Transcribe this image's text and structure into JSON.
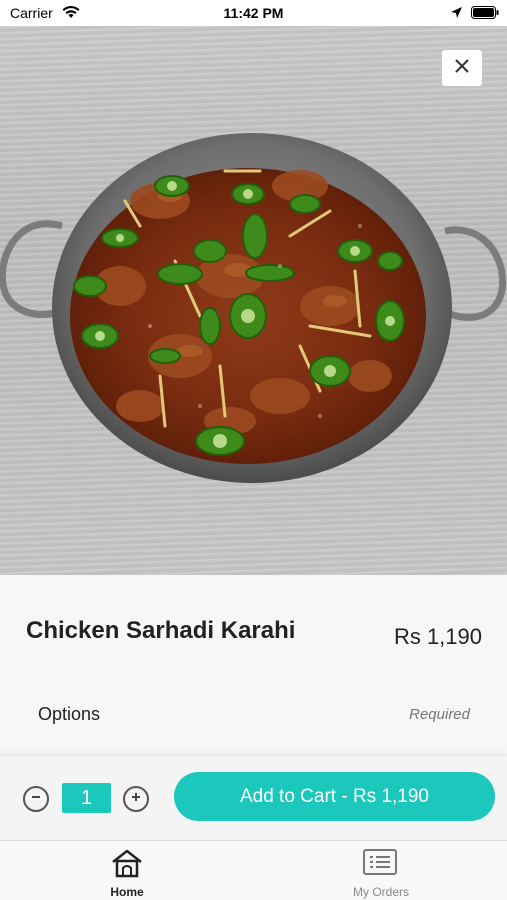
{
  "status_bar": {
    "carrier": "Carrier",
    "time": "11:42 PM",
    "icons": [
      "wifi-icon",
      "location-arrow-icon",
      "battery-icon"
    ]
  },
  "hero": {
    "image": "food-photo-chicken-karahi",
    "close_icon": "close-icon"
  },
  "item": {
    "name": "Chicken Sarhadi Karahi",
    "price": "Rs 1,190"
  },
  "options": {
    "label": "Options",
    "required": "Required"
  },
  "cart": {
    "quantity": "1",
    "minus_icon": "minus-icon",
    "plus_icon": "plus-icon",
    "add_button": "Add to Cart - Rs 1,190"
  },
  "tabs": [
    {
      "label": "Home",
      "icon": "home-icon",
      "active": true
    },
    {
      "label": "My Orders",
      "icon": "orders-list-icon",
      "active": false
    }
  ],
  "colors": {
    "accent": "#1cc8bb",
    "text": "#222222",
    "muted": "#888888"
  }
}
